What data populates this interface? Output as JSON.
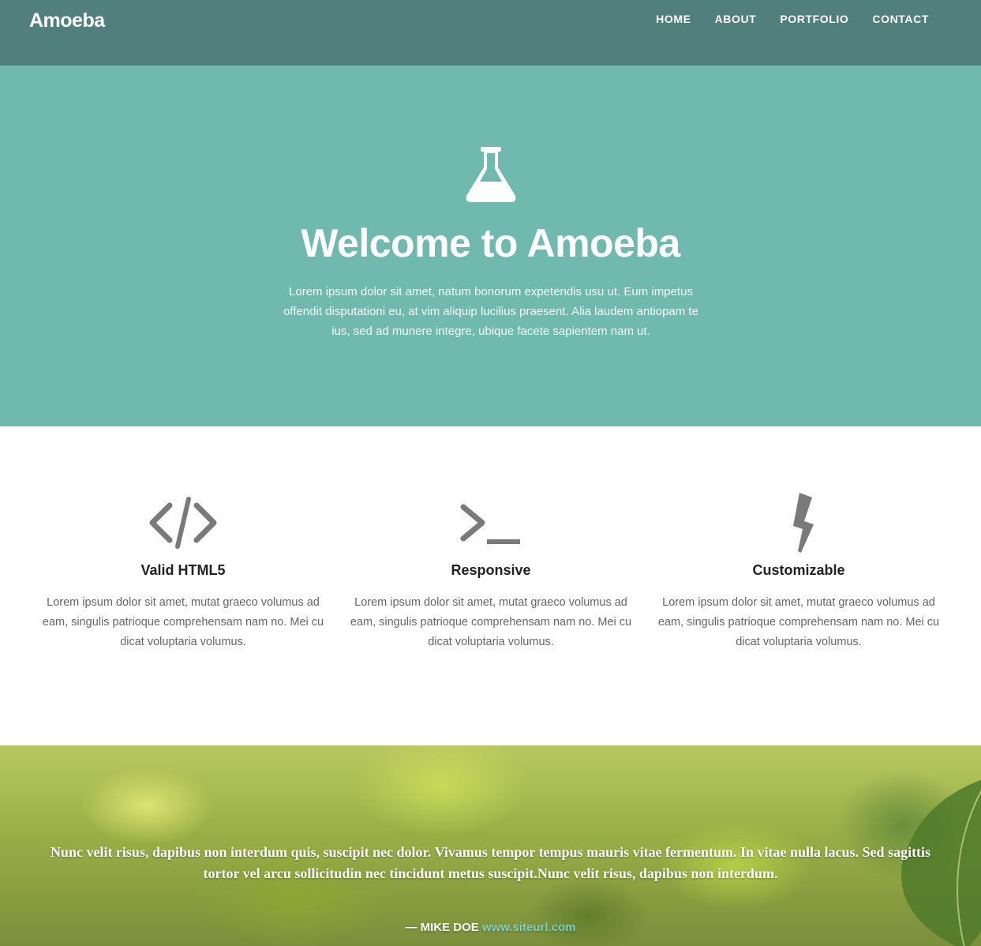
{
  "brand": "Amoeba",
  "nav": [
    {
      "label": "HOME"
    },
    {
      "label": "ABOUT"
    },
    {
      "label": "PORTFOLIO"
    },
    {
      "label": "CONTACT"
    }
  ],
  "hero": {
    "icon": "flask-icon",
    "title": "Welcome to Amoeba",
    "text": "Lorem ipsum dolor sit amet, natum bonorum expetendis usu ut. Eum impetus offendit disputationi eu, at vim aliquip lucilius praesent. Alia laudem antiopam te ius, sed ad munere integre, ubique facete sapientem nam ut."
  },
  "features": [
    {
      "icon": "code-icon",
      "title": "Valid HTML5",
      "text": "Lorem ipsum dolor sit amet, mutat graeco volumus ad eam, singulis patrioque comprehensam nam no. Mei cu dicat voluptaria volumus."
    },
    {
      "icon": "terminal-icon",
      "title": "Responsive",
      "text": "Lorem ipsum dolor sit amet, mutat graeco volumus ad eam, singulis patrioque comprehensam nam no. Mei cu dicat voluptaria volumus."
    },
    {
      "icon": "lightning-icon",
      "title": "Customizable",
      "text": "Lorem ipsum dolor sit amet, mutat graeco volumus ad eam, singulis patrioque comprehensam nam no. Mei cu dicat voluptaria volumus."
    }
  ],
  "quote": {
    "text": "Nunc velit risus, dapibus non interdum quis, suscipit nec dolor. Vivamus tempor tempus mauris vitae fermentum. In vitae nulla lacus. Sed sagittis tortor vel arcu sollicitudin nec tincidunt metus suscipit.Nunc velit risus, dapibus non interdum.",
    "author": "— MIKE DOE",
    "link": "www.siteurl.com"
  },
  "colors": {
    "header": "#517f7d",
    "hero": "#70b9ae",
    "link": "#7fd0c4",
    "icon": "#7a7a7a"
  }
}
